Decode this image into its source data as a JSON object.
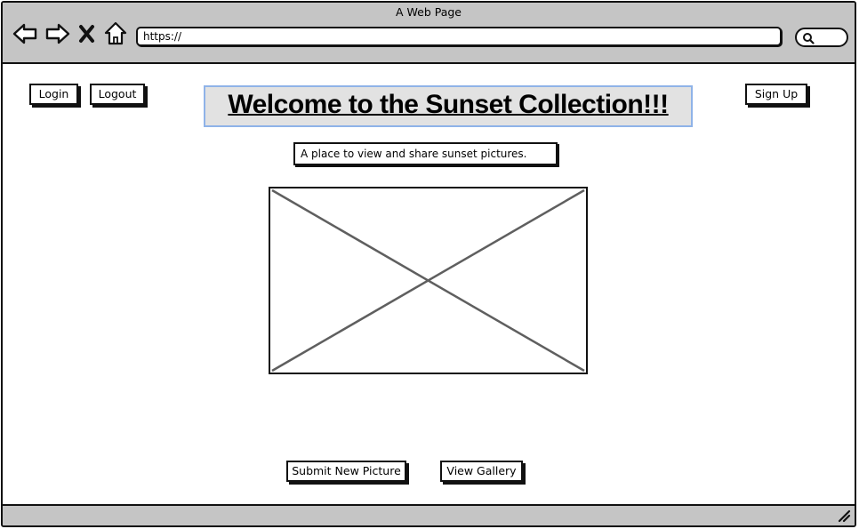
{
  "browser": {
    "window_title": "A Web Page",
    "url": "https://",
    "icons": [
      "back-arrow-icon",
      "forward-arrow-icon",
      "close-x-icon",
      "home-icon",
      "search-icon",
      "resize-grip-icon"
    ]
  },
  "header": {
    "login_label": "Login",
    "logout_label": "Logout",
    "signup_label": "Sign Up",
    "title": "Welcome to the Sunset Collection!!!",
    "subtitle": "A place to view and share sunset pictures."
  },
  "actions": {
    "submit_label": "Submit New Picture",
    "gallery_label": "View Gallery"
  },
  "colors": {
    "chrome_gray": "#c5c5c5",
    "headline_bg": "#e2e2e2",
    "headline_border": "#8fb3e8",
    "placeholder_stroke": "#5f5f5f"
  }
}
